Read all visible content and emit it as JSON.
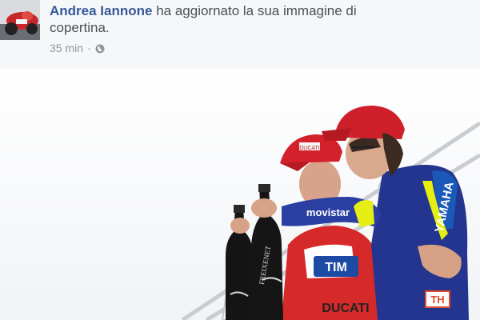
{
  "post": {
    "author": "Andrea Iannone",
    "action": " ha aggiornato la sua immagine di copertina.",
    "timestamp": "35 min",
    "separator": "·",
    "audience_icon": "globe-icon"
  },
  "cover_photo": {
    "description_icon": "cover-photo",
    "sponsor_left": "FREIXENET",
    "sponsor_right": "TIM",
    "brand_bottom": "DUCATI",
    "sleeve_logo": "movistar",
    "sleeve_logo2": "YAMAHA",
    "cap_logo": "DUCATI",
    "badge": "TH"
  }
}
